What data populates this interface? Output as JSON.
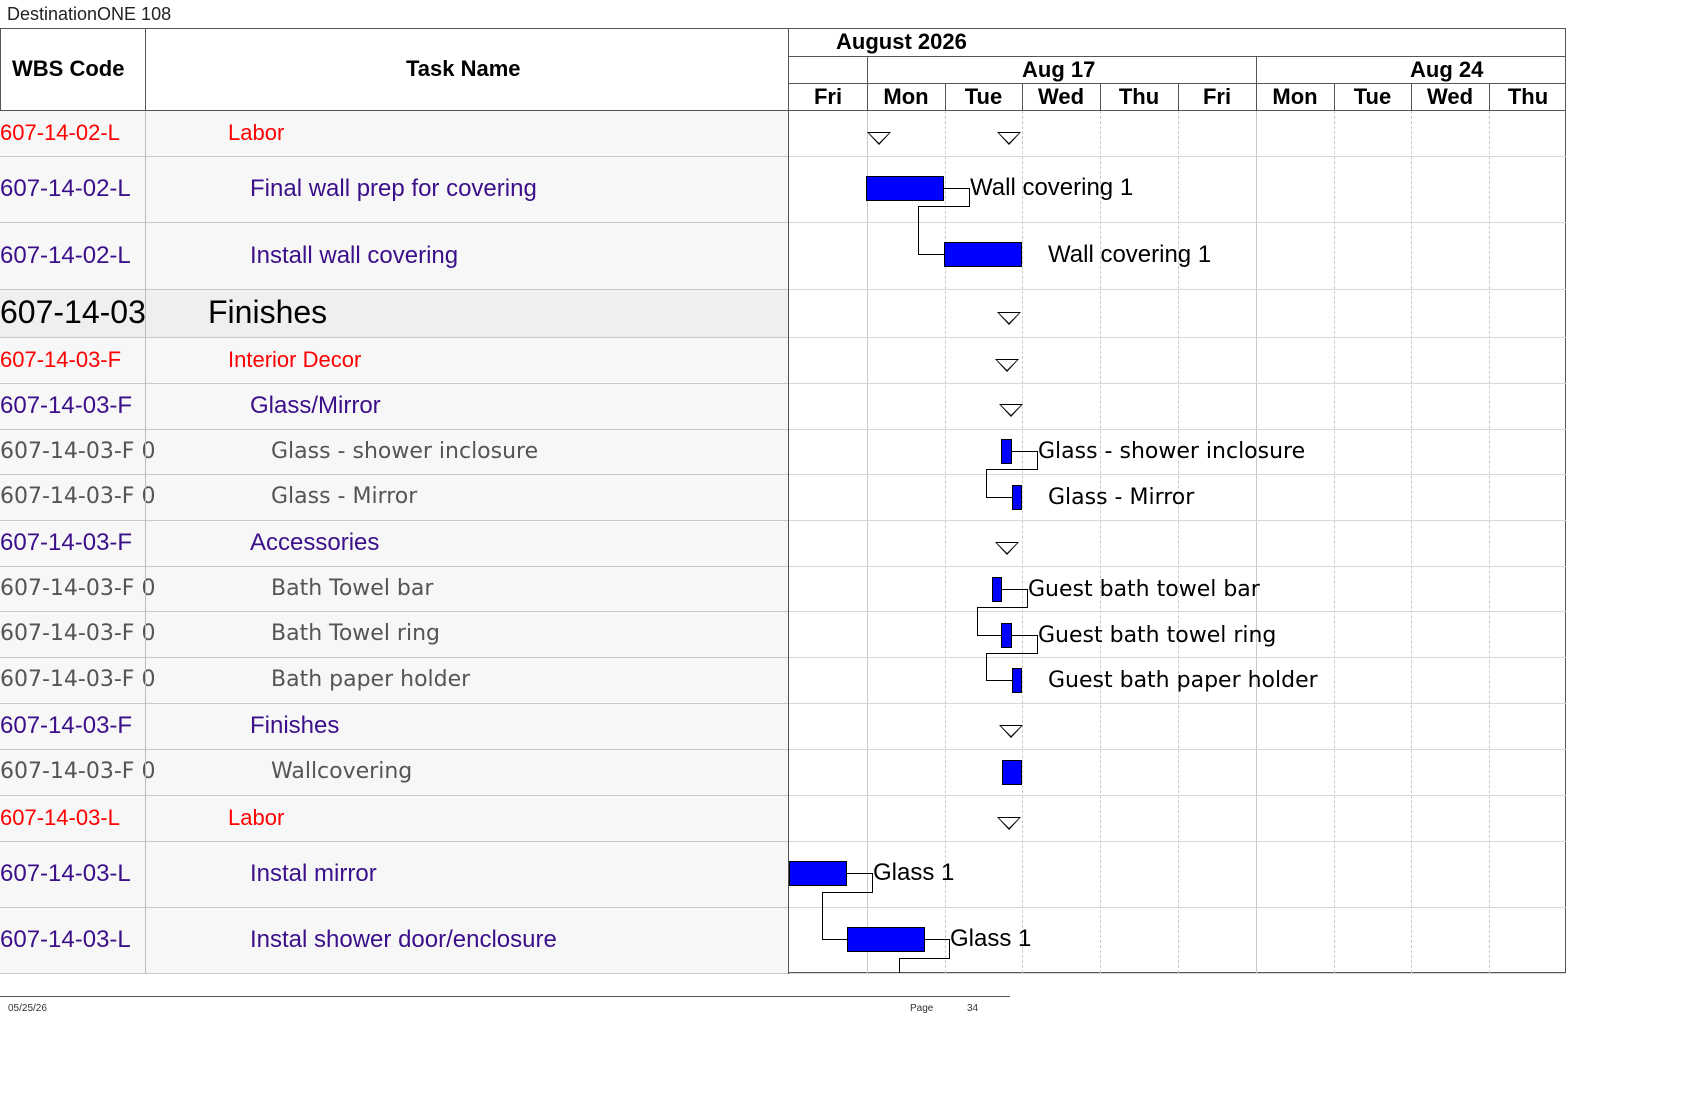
{
  "app_title": "DestinationONE 108",
  "columns": {
    "wbs": "WBS Code",
    "task": "Task Name"
  },
  "timeline": {
    "month": "August 2026",
    "weeks": [
      "Aug 17",
      "Aug 24"
    ],
    "days": [
      "Fri",
      "Mon",
      "Tue",
      "Wed",
      "Thu",
      "Fri",
      "Mon",
      "Tue",
      "Wed",
      "Thu"
    ]
  },
  "rows": [
    {
      "wbs": "607-14-02-L",
      "name": "Labor",
      "level": "summary2",
      "color": "#ff0000"
    },
    {
      "wbs": "607-14-02-L",
      "name": "Final wall prep for covering",
      "level": "task",
      "color": "#3b0f8a",
      "bar_label": "Wall covering 1"
    },
    {
      "wbs": "607-14-02-L",
      "name": "Install wall covering",
      "level": "task",
      "color": "#3b0f8a",
      "bar_label": "Wall covering 1"
    },
    {
      "wbs": "607-14-03",
      "name": "Finishes",
      "level": "summary1",
      "color": "#000000"
    },
    {
      "wbs": "607-14-03-F",
      "name": "Interior Decor",
      "level": "summary2",
      "color": "#ff0000"
    },
    {
      "wbs": "607-14-03-F",
      "name": "Glass/Mirror",
      "level": "task",
      "color": "#3b0f8a"
    },
    {
      "wbs": "607-14-03-F 0",
      "name": "Glass - shower inclosure",
      "level": "item",
      "color": "#555555",
      "bar_label": "Glass - shower inclosure"
    },
    {
      "wbs": "607-14-03-F 0",
      "name": "Glass - Mirror",
      "level": "item",
      "color": "#555555",
      "bar_label": "Glass - Mirror"
    },
    {
      "wbs": "607-14-03-F",
      "name": "Accessories",
      "level": "task",
      "color": "#3b0f8a"
    },
    {
      "wbs": "607-14-03-F 0",
      "name": "Bath Towel bar",
      "level": "item",
      "color": "#555555",
      "bar_label": "Guest bath towel bar"
    },
    {
      "wbs": "607-14-03-F 0",
      "name": "Bath Towel ring",
      "level": "item",
      "color": "#555555",
      "bar_label": "Guest bath towel ring"
    },
    {
      "wbs": "607-14-03-F 0",
      "name": "Bath paper holder",
      "level": "item",
      "color": "#555555",
      "bar_label": "Guest bath paper holder"
    },
    {
      "wbs": "607-14-03-F",
      "name": "Finishes",
      "level": "task",
      "color": "#3b0f8a"
    },
    {
      "wbs": "607-14-03-F 0",
      "name": "Wallcovering",
      "level": "item",
      "color": "#555555"
    },
    {
      "wbs": "607-14-03-L",
      "name": "Labor",
      "level": "summary2",
      "color": "#ff0000"
    },
    {
      "wbs": "607-14-03-L",
      "name": "Instal mirror",
      "level": "task",
      "color": "#3b0f8a",
      "bar_label": "Glass 1"
    },
    {
      "wbs": "607-14-03-L",
      "name": "Instal shower door/enclosure",
      "level": "task",
      "color": "#3b0f8a",
      "bar_label": "Glass 1"
    }
  ],
  "footer": {
    "date": "05/25/26",
    "page_label": "Page",
    "page_number": "34"
  },
  "colors": {
    "bar": "#0000ff",
    "summary_row_bg": "#efefef",
    "row_bg": "#f7f7f7"
  }
}
